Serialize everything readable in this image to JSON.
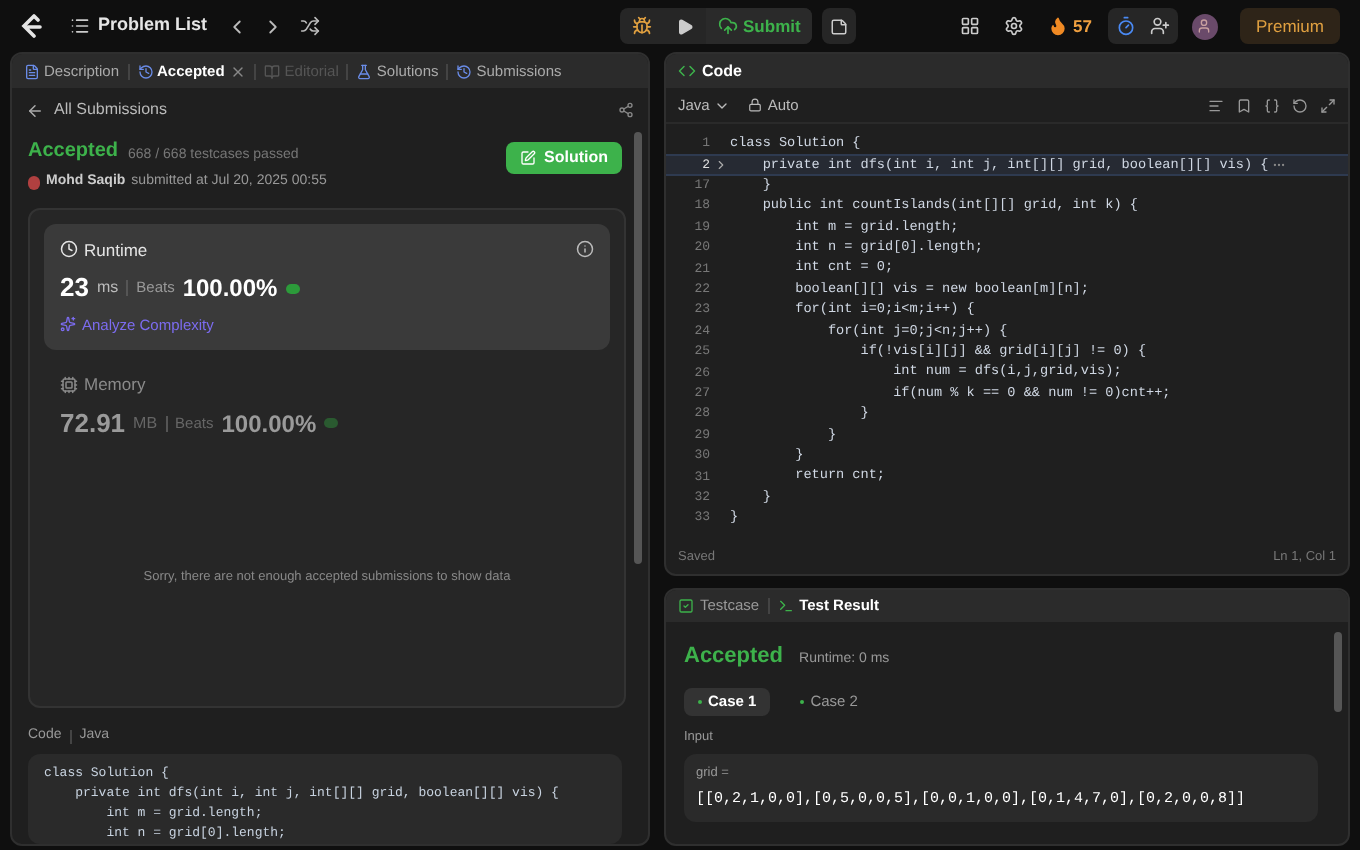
{
  "top_bar": {
    "title": "Problem List",
    "submit": "Submit",
    "streak": "57",
    "premium": "Premium"
  },
  "left_panel": {
    "tabs": [
      {
        "label": "Description",
        "selected": false,
        "disabled": false,
        "closable": false
      },
      {
        "label": "Accepted",
        "selected": true,
        "disabled": false,
        "closable": true
      },
      {
        "label": "Editorial",
        "selected": false,
        "disabled": true,
        "closable": false
      },
      {
        "label": "Solutions",
        "selected": false,
        "disabled": false,
        "closable": false
      },
      {
        "label": "Submissions",
        "selected": false,
        "disabled": false,
        "closable": false
      }
    ],
    "back_link": "All Submissions",
    "result": {
      "status": "Accepted",
      "testcases": "668 / 668 testcases passed",
      "author": "Mohd Saqib",
      "submitted": "submitted at Jul 20, 2025 00:55",
      "solution_button": "Solution"
    },
    "metrics": [
      {
        "kind": "runtime",
        "label": "Runtime",
        "value": "23",
        "unit": "ms",
        "beats_label": "Beats",
        "beats": "100.00%",
        "analyze": "Analyze Complexity",
        "selected": true
      },
      {
        "kind": "memory",
        "label": "Memory",
        "value": "72.91",
        "unit": "MB",
        "beats_label": "Beats",
        "beats": "100.00%",
        "selected": false
      }
    ],
    "empty_message": "Sorry, there are not enough accepted submissions to show data",
    "code_section": {
      "label": "Code",
      "language": "Java",
      "lines": [
        "class Solution {",
        "    private int dfs(int i, int j, int[][] grid, boolean[][] vis) {",
        "        int m = grid.length;",
        "        int n = grid[0].length;"
      ]
    }
  },
  "editor": {
    "title": "Code",
    "language": "Java",
    "mode": "Auto",
    "lines": [
      {
        "number": "1",
        "text": "class Solution {",
        "current": false
      },
      {
        "number": "2",
        "text": "    private int dfs(int i, int j, int[][] grid, boolean[][] vis) {",
        "current": true,
        "folded": true
      },
      {
        "number": "17",
        "text": "    }",
        "current": false
      },
      {
        "number": "18",
        "text": "    public int countIslands(int[][] grid, int k) {",
        "current": false
      },
      {
        "number": "19",
        "text": "        int m = grid.length;",
        "current": false
      },
      {
        "number": "20",
        "text": "        int n = grid[0].length;",
        "current": false
      },
      {
        "number": "21",
        "text": "        int cnt = 0;",
        "current": false
      },
      {
        "number": "22",
        "text": "        boolean[][] vis = new boolean[m][n];",
        "current": false
      },
      {
        "number": "23",
        "text": "        for(int i=0;i<m;i++) {",
        "current": false
      },
      {
        "number": "24",
        "text": "            for(int j=0;j<n;j++) {",
        "current": false
      },
      {
        "number": "25",
        "text": "                if(!vis[i][j] && grid[i][j] != 0) {",
        "current": false
      },
      {
        "number": "26",
        "text": "                    int num = dfs(i,j,grid,vis);",
        "current": false
      },
      {
        "number": "27",
        "text": "                    if(num % k == 0 && num != 0)cnt++;",
        "current": false
      },
      {
        "number": "28",
        "text": "                }",
        "current": false
      },
      {
        "number": "29",
        "text": "            }",
        "current": false
      },
      {
        "number": "30",
        "text": "        }",
        "current": false
      },
      {
        "number": "31",
        "text": "        return cnt;",
        "current": false
      },
      {
        "number": "32",
        "text": "    }",
        "current": false
      },
      {
        "number": "33",
        "text": "}",
        "current": false
      }
    ],
    "status": "Saved",
    "cursor": "Ln 1, Col 1"
  },
  "result_panel": {
    "tabs": [
      {
        "label": "Testcase",
        "selected": false
      },
      {
        "label": "Test Result",
        "selected": true
      }
    ],
    "status": "Accepted",
    "runtime": "Runtime: 0 ms",
    "cases": [
      {
        "label": "Case 1",
        "selected": true
      },
      {
        "label": "Case 2",
        "selected": false
      }
    ],
    "input_label": "Input",
    "param": "grid =",
    "value": "[[0,2,1,0,0],[0,5,0,0,5],[0,0,1,0,0],[0,1,4,7,0],[0,2,0,0,8]]"
  }
}
